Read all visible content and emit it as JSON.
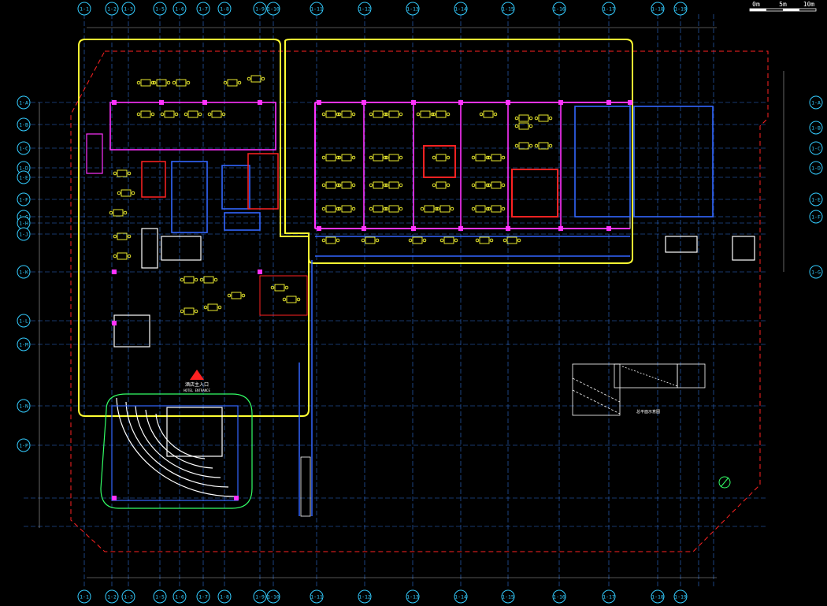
{
  "scale_bar": {
    "labels": [
      "0m",
      "5m",
      "10m"
    ]
  },
  "grid": {
    "top_labels": [
      "1-1",
      "1-2",
      "1-3",
      "1-5",
      "1-6",
      "1-7",
      "1-8",
      "1-9",
      "1-10",
      "1-11",
      "1-12",
      "1-13",
      "1-14",
      "1-15",
      "1-16",
      "1-17",
      "1-18",
      "1-19"
    ],
    "left_labels": [
      "1-A",
      "1-B",
      "1-C",
      "1-D",
      "1-E",
      "1-F",
      "1-G",
      "1-H",
      "1-J",
      "1-K",
      "1-L",
      "1-M",
      "1-N",
      "1-P"
    ],
    "right_labels": [
      "1-A",
      "1-B",
      "1-C",
      "1-D",
      "1-E",
      "1-F",
      "1-G"
    ]
  },
  "entrance": {
    "label": "酒店主入口",
    "sublabel": "HOTEL ENTRANCE"
  },
  "inset_plan": {
    "caption": "总平面示意图"
  },
  "colors": {
    "yellow": "#ffff33",
    "red": "#ff2222",
    "magenta": "#ff33ff",
    "cyan": "#33ccff",
    "blue": "#3366ff",
    "green": "#33ff66",
    "white": "#ffffff",
    "grid": "#2f6fd6"
  },
  "icons": [
    "north-arrow-icon",
    "entrance-arrow-icon"
  ]
}
